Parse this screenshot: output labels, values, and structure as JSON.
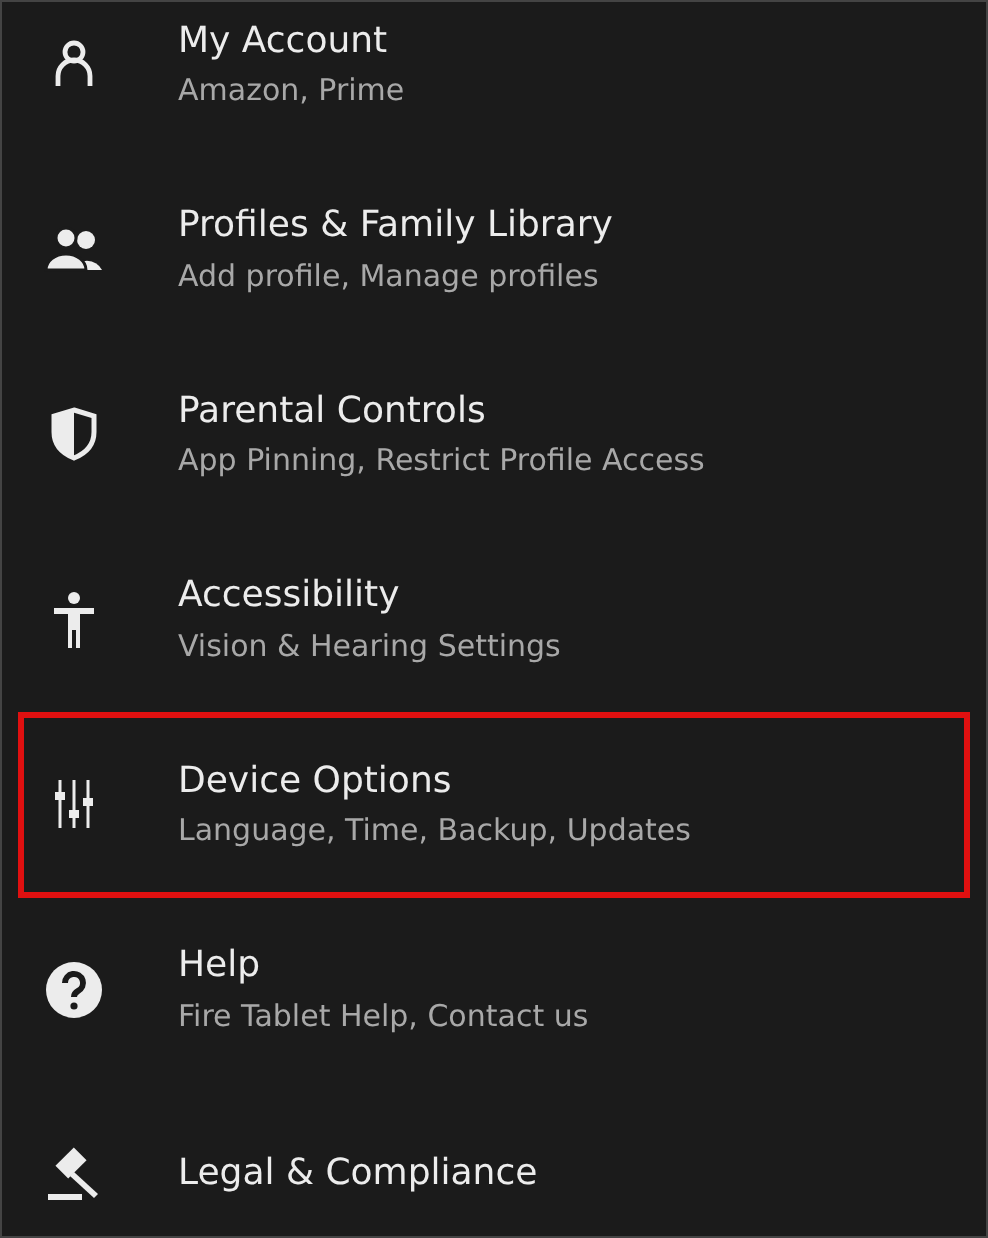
{
  "items": [
    {
      "title": "My Account",
      "subtitle": "Amazon, Prime",
      "selected": false
    },
    {
      "title": "Profiles & Family Library",
      "subtitle": "Add profile, Manage profiles",
      "selected": false
    },
    {
      "title": "Parental Controls",
      "subtitle": "App Pinning, Restrict Profile Access",
      "selected": false
    },
    {
      "title": "Accessibility",
      "subtitle": "Vision & Hearing Settings",
      "selected": false
    },
    {
      "title": "Device Options",
      "subtitle": "Language, Time, Backup, Updates",
      "selected": true
    },
    {
      "title": "Help",
      "subtitle": "Fire Tablet Help, Contact us",
      "selected": false
    },
    {
      "title": "Legal & Compliance",
      "selected": false
    }
  ]
}
